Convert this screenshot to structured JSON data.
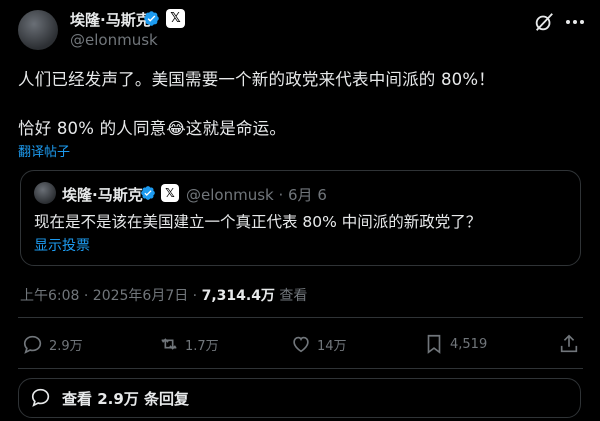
{
  "tweet": {
    "author_name": "埃隆·马斯克",
    "x_badge": "𝕏",
    "handle": "@elonmusk",
    "line1": "人们已经发声了。美国需要一个新的政党来代表中间派的 80%！",
    "line2": "恰好 80% 的人同意😂这就是命运。",
    "translate_label": "翻译帖子"
  },
  "quote": {
    "author_name": "埃隆·马斯克",
    "x_badge": "𝕏",
    "meta": "@elonmusk · 6月 6",
    "text": "现在是不是该在美国建立一个真正代表 80% 中间派的新政党了？",
    "poll_label": "显示投票"
  },
  "meta": {
    "time_date": "上午6:08 · 2025年6月7日 · ",
    "views": "7,314.4万",
    "views_suffix": " 查看"
  },
  "actions": {
    "replies": "2.9万",
    "reposts": "1.7万",
    "likes": "14万",
    "bookmarks": "4,519"
  },
  "reply_bar": {
    "label": "查看 2.9万 条回复"
  },
  "colors": {
    "accent": "#1d9bf0",
    "muted": "#71767b",
    "text": "#e7e9ea",
    "border": "#2f3336"
  },
  "icons": [
    "verified-icon",
    "grok-icon",
    "more-icon",
    "reply-icon",
    "repost-icon",
    "like-icon",
    "bookmark-icon",
    "share-icon"
  ]
}
